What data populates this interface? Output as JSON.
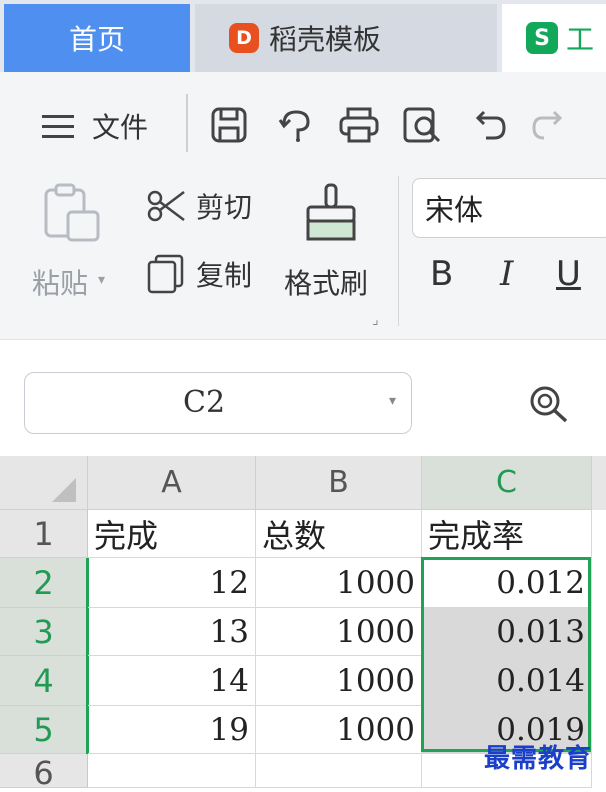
{
  "tabs": {
    "home": "首页",
    "template": "稻壳模板",
    "template_logo": "D",
    "doc_logo": "S",
    "doc_partial": "工"
  },
  "toolbar": {
    "file_menu": "文件",
    "cut": "剪切",
    "copy": "复制",
    "paste": "粘贴",
    "format_painter": "格式刷",
    "font_name": "宋体",
    "bold": "B",
    "italic": "I",
    "underline": "U"
  },
  "namebox": {
    "value": "C2"
  },
  "grid": {
    "columns": [
      "A",
      "B",
      "C"
    ],
    "rows": [
      "1",
      "2",
      "3",
      "4",
      "5",
      "6"
    ],
    "cells": [
      [
        "完成",
        "总数",
        "完成率"
      ],
      [
        "12",
        "1000",
        "0.012"
      ],
      [
        "13",
        "1000",
        "0.013"
      ],
      [
        "14",
        "1000",
        "0.014"
      ],
      [
        "19",
        "1000",
        "0.019"
      ]
    ]
  },
  "watermark": "最需教育",
  "colors": {
    "accent_blue": "#4e8ff0",
    "selection_green": "#21a356"
  }
}
